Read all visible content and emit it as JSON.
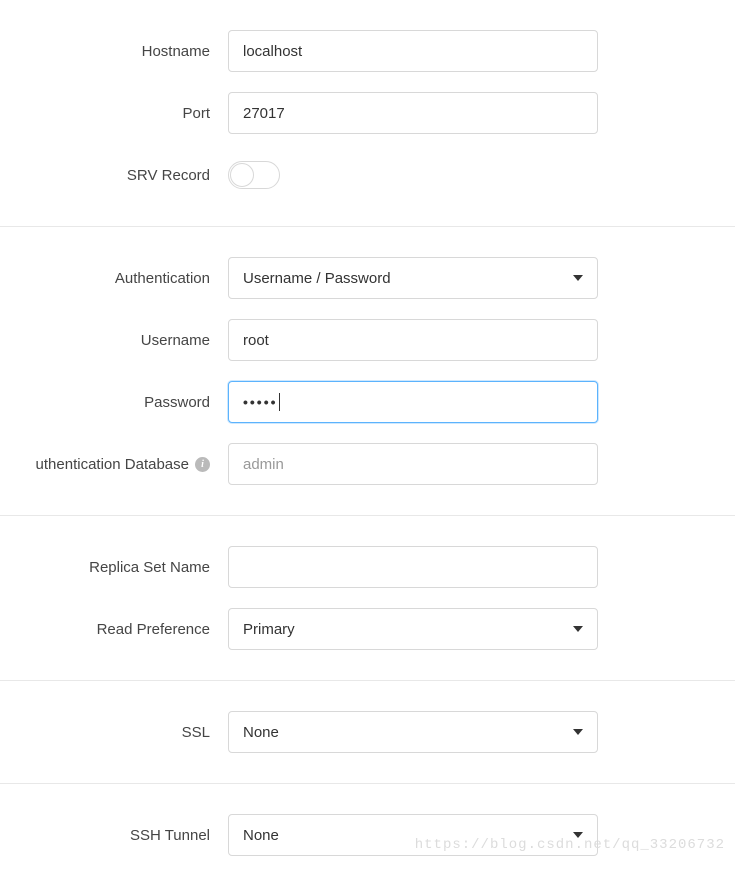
{
  "connection": {
    "hostname_label": "Hostname",
    "hostname_value": "localhost",
    "port_label": "Port",
    "port_value": "27017",
    "srv_label": "SRV Record",
    "srv_on": false
  },
  "auth": {
    "authentication_label": "Authentication",
    "authentication_value": "Username / Password",
    "username_label": "Username",
    "username_value": "root",
    "password_label": "Password",
    "password_value": "•••••",
    "authdb_label": "uthentication Database",
    "authdb_placeholder": "admin",
    "authdb_value": ""
  },
  "replica": {
    "replica_label": "Replica Set Name",
    "replica_value": "",
    "readpref_label": "Read Preference",
    "readpref_value": "Primary"
  },
  "ssl": {
    "ssl_label": "SSL",
    "ssl_value": "None"
  },
  "ssh": {
    "ssh_label": "SSH Tunnel",
    "ssh_value": "None"
  },
  "watermark": "https://blog.csdn.net/qq_33206732"
}
